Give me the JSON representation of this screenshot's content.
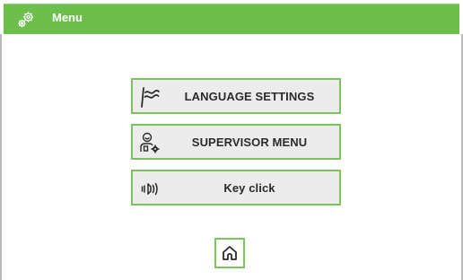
{
  "header": {
    "title": "Menu",
    "icon": "gears-icon",
    "color": "#6cbf4a"
  },
  "menu": {
    "items": [
      {
        "label": "LANGUAGE SETTINGS",
        "icon": "flag-icon"
      },
      {
        "label": "SUPERVISOR MENU",
        "icon": "supervisor-icon"
      },
      {
        "label": "Key click",
        "icon": "vibration-icon"
      }
    ]
  },
  "footer": {
    "home_icon": "home-icon"
  },
  "colors": {
    "accent": "#7dc35c",
    "button_bg": "#ececec",
    "text": "#2b2b2b"
  }
}
